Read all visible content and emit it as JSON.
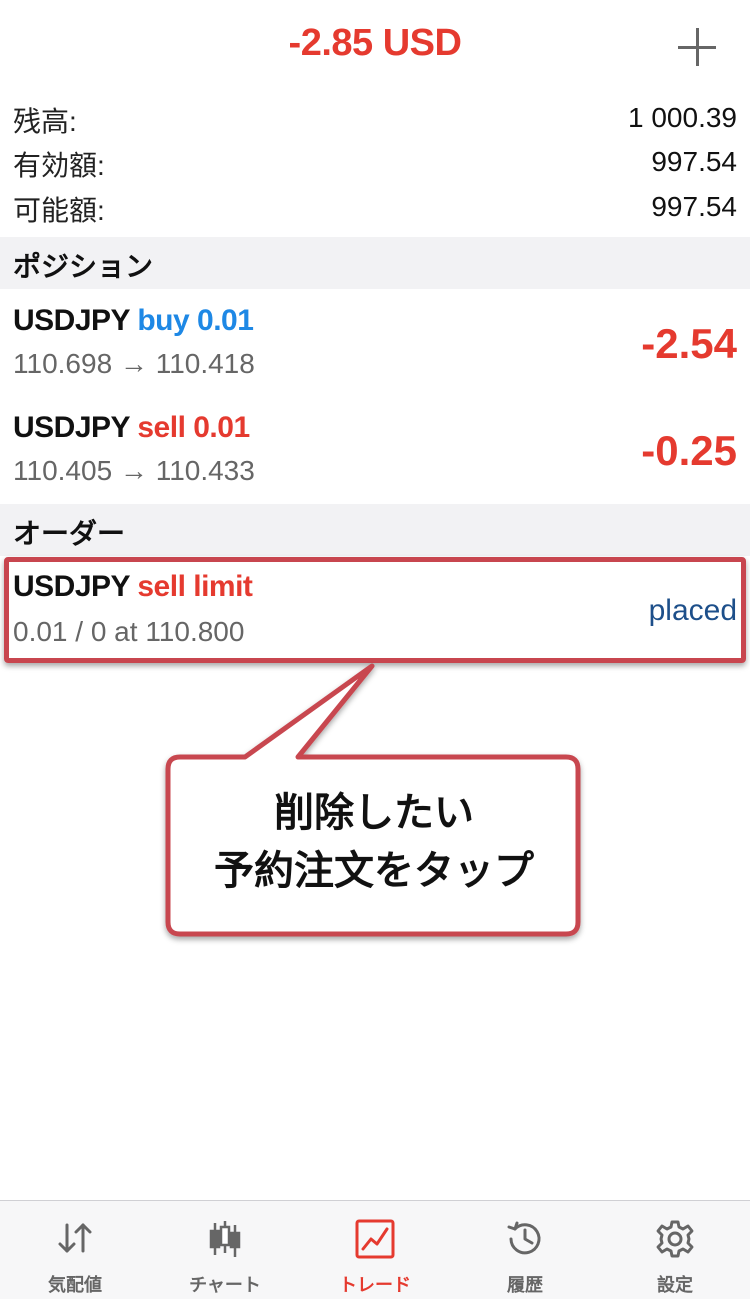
{
  "header": {
    "title": "-2.85 USD",
    "add_icon": "plus-icon"
  },
  "summary": [
    {
      "label": "残高:",
      "value": "1 000.39"
    },
    {
      "label": "有効額:",
      "value": "997.54"
    },
    {
      "label": "可能額:",
      "value": "997.54"
    }
  ],
  "positions": {
    "section_title": "ポジション",
    "items": [
      {
        "symbol": "USDJPY",
        "side": "buy 0.01",
        "prices": "110.698 → 110.418",
        "profit": "-2.54",
        "side_color": "#1e88e5"
      },
      {
        "symbol": "USDJPY",
        "side": "sell 0.01",
        "prices": "110.405 → 110.433",
        "profit": "-0.25",
        "side_color": "#e53a2f"
      }
    ]
  },
  "orders": {
    "section_title": "オーダー",
    "items": [
      {
        "symbol": "USDJPY",
        "side": "sell limit",
        "detail": "0.01 / 0 at 110.800",
        "status": "placed"
      }
    ]
  },
  "callout": {
    "line1": "削除したい",
    "line2": "予約注文をタップ"
  },
  "tabbar": [
    {
      "label": "気配値",
      "icon": "quotes-arrows-icon",
      "active": false
    },
    {
      "label": "チャート",
      "icon": "candlestick-chart-icon",
      "active": false
    },
    {
      "label": "トレード",
      "icon": "trade-chart-icon",
      "active": true
    },
    {
      "label": "履歴",
      "icon": "history-clock-icon",
      "active": false
    },
    {
      "label": "設定",
      "icon": "gear-icon",
      "active": false
    }
  ],
  "colors": {
    "accent_red": "#e53a2f",
    "buy_blue": "#1e88e5",
    "status_blue": "#1d4f8a",
    "highlight_border": "#c8464f"
  }
}
